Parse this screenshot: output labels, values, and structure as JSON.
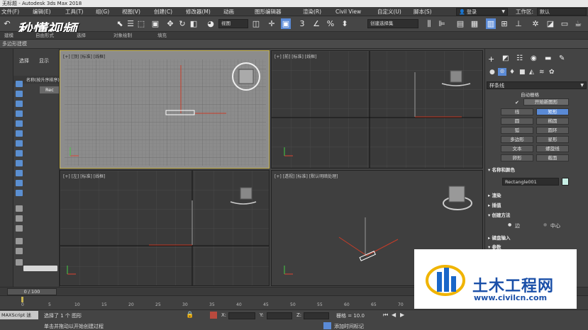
{
  "titlebar": {
    "text": "无标题 - Autodesk 3ds Max 2018"
  },
  "menu": [
    "文件(F)",
    "编辑(E)",
    "工具(T)",
    "组(G)",
    "视图(V)",
    "创建(C)",
    "修改器(M)",
    "动画",
    "图形编辑器",
    "渲染(R)",
    "Civil View",
    "自定义(U)",
    "脚本(S)"
  ],
  "account": {
    "login": "登录",
    "workspace_label": "工作区:",
    "workspace_value": "默认"
  },
  "toolbar": {
    "view_select": "视图",
    "selection_set": "创建选择集"
  },
  "ribbon": {
    "tabs": [
      "建模",
      "自由形式",
      "选择",
      "对象绘制",
      "填充"
    ]
  },
  "subbar": {
    "text": "多边形建模"
  },
  "scene_explorer": {
    "tab_select": "选择",
    "tab_display": "显示",
    "header": "名称(按升序排序)",
    "item": "Rec"
  },
  "viewports": {
    "top": "[+] [顶] [标准] [线框]",
    "front": "[+] [前] [标准] [线框]",
    "left": "[+] [左] [标准] [线框]",
    "perspective": "[+] [透视] [标准] [默认明暗处理]"
  },
  "command_panel": {
    "category": "样条线",
    "autogrid": "自动栅格",
    "start_new_shape": "开始新图形",
    "shapes": [
      "线",
      "矩形",
      "圆",
      "椭圆",
      "弧",
      "圆环",
      "多边形",
      "星形",
      "文本",
      "螺旋线",
      "卵形",
      "截面"
    ],
    "name_color_rollout": "名称和颜色",
    "object_name": "Rectangle001",
    "rollouts": [
      "渲染",
      "插值",
      "创建方法",
      "键盘输入",
      "参数"
    ],
    "creation_edge": "边",
    "creation_center": "中心"
  },
  "timeline": {
    "frame": "0 / 100",
    "ticks": [
      "0",
      "5",
      "10",
      "15",
      "20",
      "25",
      "30",
      "35",
      "40",
      "45",
      "50",
      "55",
      "60",
      "65",
      "70"
    ]
  },
  "status": {
    "maxscript": "MAXScript 迷",
    "selected": "选择了 1 个 图形",
    "prompt": "单击并拖动以开始创建过程",
    "x_label": "X:",
    "y_label": "Y:",
    "z_label": "Z:",
    "grid": "栅格 = 10.0",
    "add_time_tag": "添加时间标记"
  },
  "watermark": {
    "logo_text": "秒懂视频",
    "site_name": "土木工程网",
    "site_url": "www.civilcn.com"
  },
  "colors": {
    "accent": "#5a8ad6",
    "selection_yellow": "#c8b450",
    "axis_red": "#c83c28"
  }
}
